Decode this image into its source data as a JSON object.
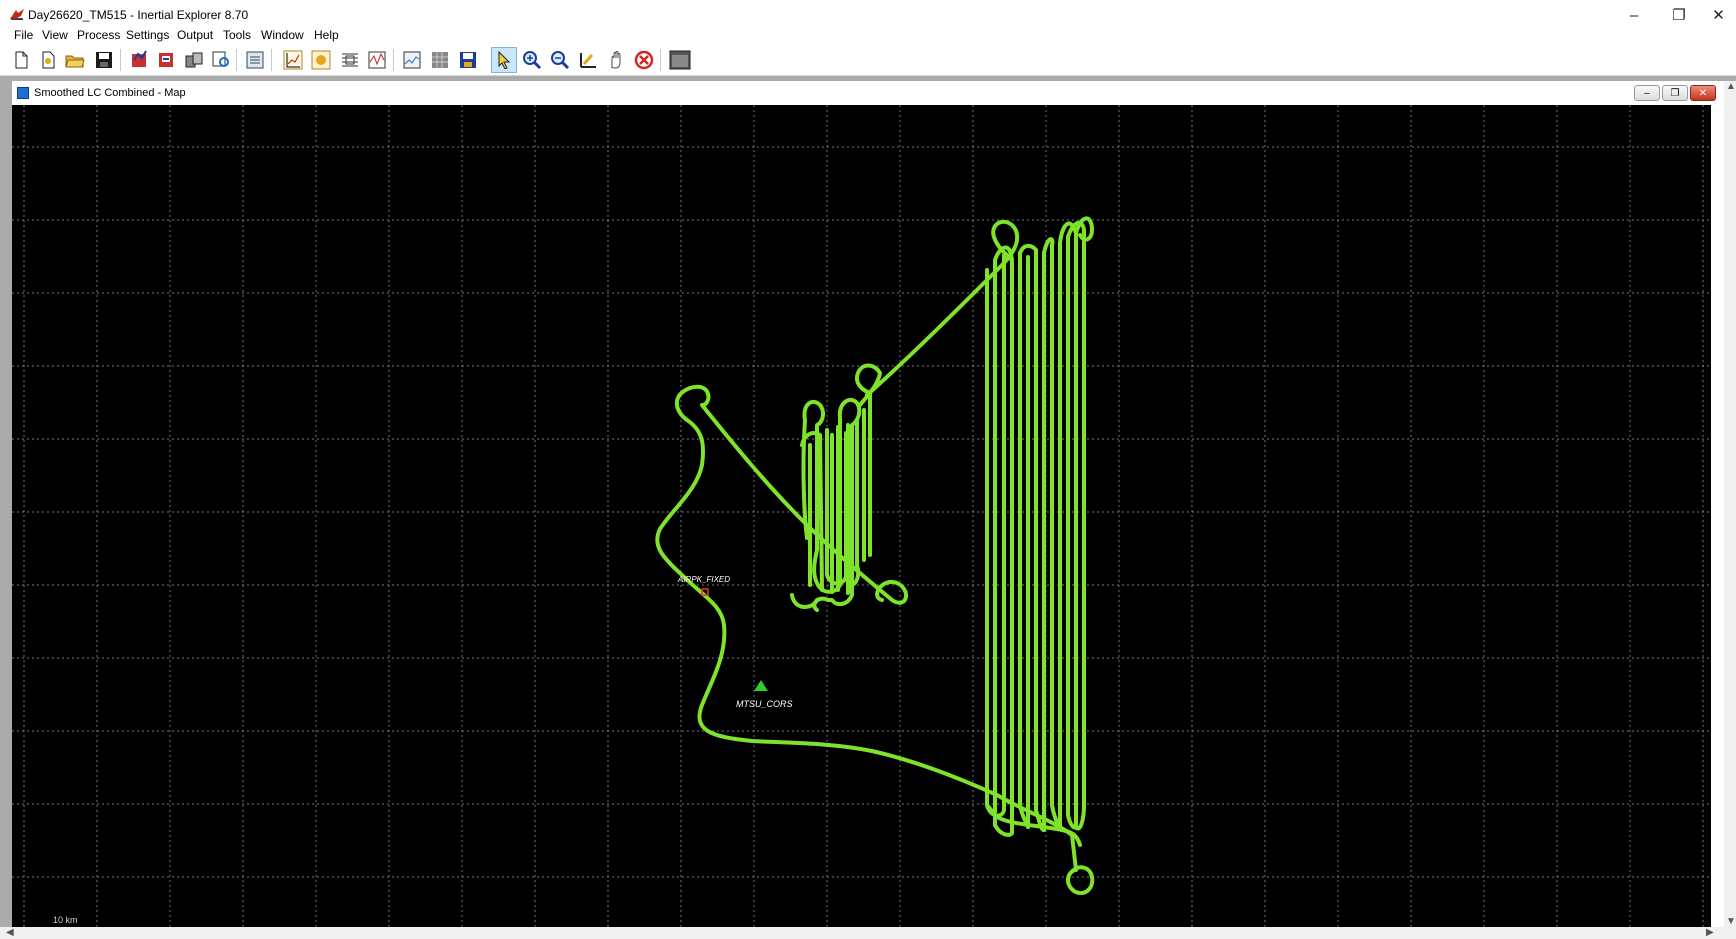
{
  "window": {
    "title": "Day26620_TM515 - Inertial Explorer 8.70",
    "minimize_glyph": "–",
    "maximize_glyph": "❐",
    "close_glyph": "✕"
  },
  "menu": {
    "file": "File",
    "view": "View",
    "process": "Process",
    "settings": "Settings",
    "output": "Output",
    "tools": "Tools",
    "window": "Window",
    "help": "Help"
  },
  "toolbar": {
    "icons": [
      "new-file-icon",
      "open-project-icon",
      "open-folder-icon",
      "save-icon",
      "process-gnss-icon",
      "process-tc-icon",
      "combine-icon",
      "view-file-icon",
      "properties-icon",
      "plot-icon",
      "output-icon",
      "export-icon",
      "multi-plot-icon",
      "map-icon",
      "grid-icon",
      "save-map-icon",
      "select-pointer-icon",
      "zoom-in-icon",
      "zoom-out-icon",
      "measure-icon",
      "pan-hand-icon",
      "stop-icon",
      "window-icon"
    ],
    "active": "select-pointer-icon"
  },
  "map_window": {
    "title": "Smoothed LC Combined - Map",
    "scale_label": "10 km",
    "background": "#000000",
    "grid_color": "#a0a0a0",
    "track_color": "#7ee32a",
    "stations": [
      {
        "name": "MTSU_CORS",
        "color": "#2ecc2e",
        "marker": "triangle"
      },
      {
        "name": "AIRPK_FIXED",
        "color": "#e03a2a",
        "marker": "square"
      }
    ]
  }
}
